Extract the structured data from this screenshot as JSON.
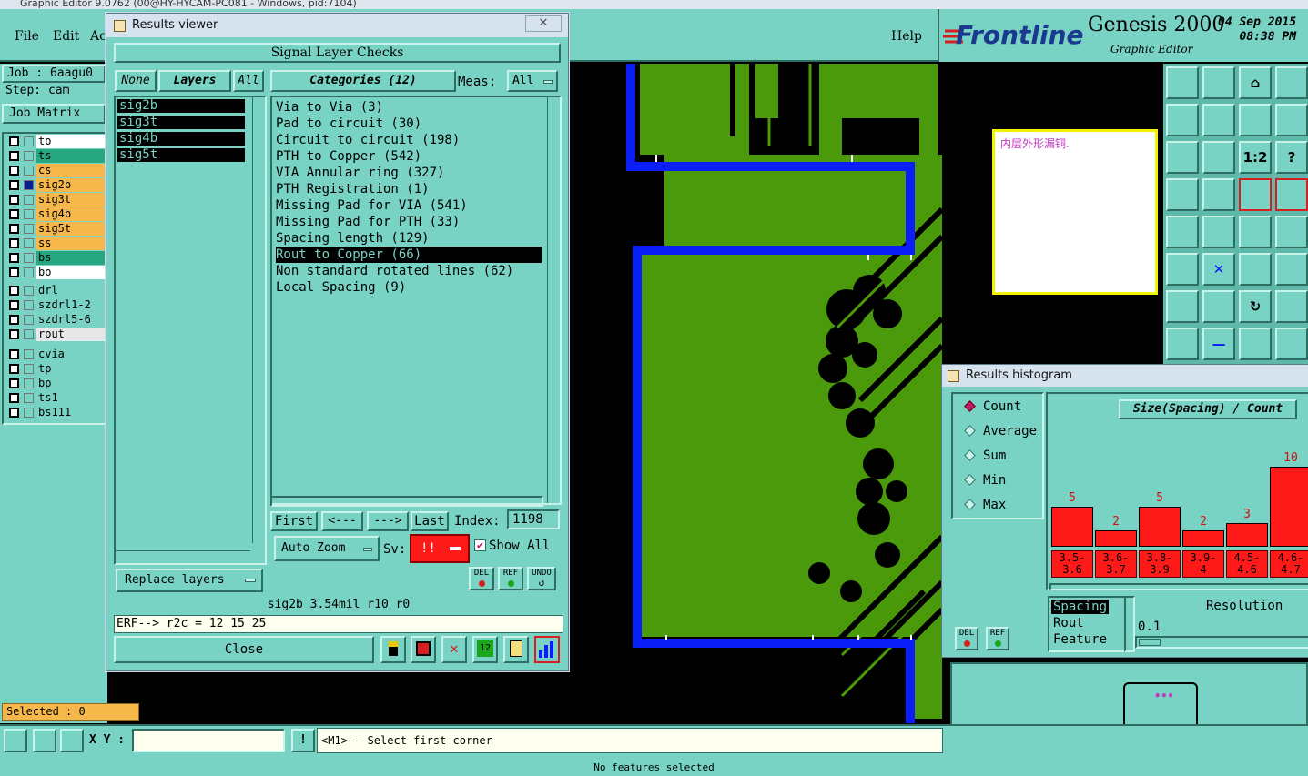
{
  "os_title": "Graphic Editor 9.0762 (00@HY-HYCAM-PC081 - Windows, pid:7104)",
  "menu": {
    "file": "File",
    "edit": "Edit",
    "actions": "Ac",
    "help": "Help"
  },
  "brand": {
    "logo": "Frontline",
    "product": "Genesis 2000",
    "subtitle": "Graphic Editor",
    "date": "04 Sep 2015",
    "time": "08:38 PM"
  },
  "left": {
    "job": "Job : 6aagu0",
    "step": "Step: cam",
    "job_matrix": "Job Matrix",
    "layers_group1": [
      {
        "name": "to",
        "color": "#ffffff"
      },
      {
        "name": "ts",
        "color": "#27a77f"
      },
      {
        "name": "cs",
        "color": "#f6b84b"
      },
      {
        "name": "sig2b",
        "color": "#f6b84b"
      },
      {
        "name": "sig3t",
        "color": "#f6b84b"
      },
      {
        "name": "sig4b",
        "color": "#f6b84b"
      },
      {
        "name": "sig5t",
        "color": "#f6b84b"
      },
      {
        "name": "ss",
        "color": "#f6b84b"
      },
      {
        "name": "bs",
        "color": "#27a77f"
      },
      {
        "name": "bo",
        "color": "#ffffff"
      }
    ],
    "layers_group2": [
      {
        "name": "drl",
        "color": "#79d3c4"
      },
      {
        "name": "szdrl1-2",
        "color": "#79d3c4"
      },
      {
        "name": "szdrl5-6",
        "color": "#79d3c4"
      },
      {
        "name": "rout",
        "color": "#e8e8e8"
      }
    ],
    "layers_group3": [
      {
        "name": "cvia",
        "color": "#79d3c4"
      },
      {
        "name": "tp",
        "color": "#79d3c4"
      },
      {
        "name": "bp",
        "color": "#79d3c4"
      },
      {
        "name": "ts1",
        "color": "#79d3c4"
      },
      {
        "name": "bs111",
        "color": "#79d3c4"
      }
    ],
    "selected": "Selected : 0"
  },
  "note": {
    "text": "内层外形漏铜."
  },
  "results_viewer": {
    "title": "Results viewer",
    "header": "Signal Layer Checks",
    "none_btn": "None",
    "layers_btn": "Layers",
    "all_btn": "All",
    "categories_btn": "Categories (12)",
    "meas_label": "Meas:",
    "meas_value": "All",
    "layers": [
      "sig2b",
      "sig3t",
      "sig4b",
      "sig5t"
    ],
    "categories": [
      "Via to Via (3)",
      "Pad to circuit (30)",
      "Circuit to circuit (198)",
      "PTH to Copper (542)",
      "VIA Annular ring (327)",
      "PTH Registration (1)",
      "Missing Pad for VIA (541)",
      "Missing Pad for PTH (33)",
      "Spacing length (129)",
      "Rout to Copper (66)",
      "Non standard rotated lines (62)",
      "Local Spacing (9)"
    ],
    "selected_category_index": 9,
    "first": "First",
    "prev": "<---",
    "next": "--->",
    "last": "Last",
    "index_label": "Index:",
    "index_value": "1198",
    "auto_zoom": "Auto Zoom",
    "sv_label": "Sv:",
    "sv_value": "!!",
    "show_all": "Show All",
    "replace_layers": "Replace layers",
    "del": "DEL",
    "ref": "REF",
    "undo": "UNDO",
    "info_line": "sig2b 3.54mil   r10   r0",
    "erf_line": "ERF--> r2c = 12 15 25",
    "close": "Close"
  },
  "histogram": {
    "title": "Results histogram",
    "options": [
      "Count",
      "Average",
      "Sum",
      "Min",
      "Max"
    ],
    "selected_option": "Count",
    "chart_title": "Size(Spacing) / Count",
    "bins": [
      {
        "label1": "3.5-",
        "label2": "3.6",
        "value": 5
      },
      {
        "label1": "3.6-",
        "label2": "3.7",
        "value": 2
      },
      {
        "label1": "3.8-",
        "label2": "3.9",
        "value": 5
      },
      {
        "label1": "3.9-",
        "label2": "4",
        "value": 2
      },
      {
        "label1": "4.5-",
        "label2": "4.6",
        "value": 3
      },
      {
        "label1": "4.6-",
        "label2": "4.7",
        "value": 10
      }
    ],
    "list": [
      "Spacing",
      "Rout",
      "Feature"
    ],
    "resolution_label": "Resolution",
    "resolution_value": "0.1",
    "del": "DEL",
    "ref": "REF"
  },
  "bottom": {
    "xy_label": "X Y :",
    "xy_value": "",
    "prompt": "<M1> - Select first corner",
    "status": "No features selected"
  },
  "colors": {
    "teal": "#79d3c4",
    "copper_green": "#4a9a0c",
    "rout_blue": "#0a1ef5",
    "highlight_red": "#ff1a1a"
  }
}
